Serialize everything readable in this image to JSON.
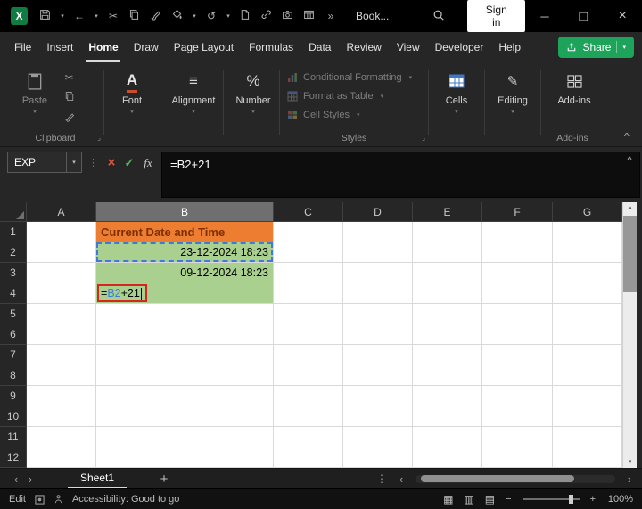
{
  "colors": {
    "excel_green": "#107C41",
    "share_green": "#1EA35B",
    "cell_orange": "#ED7D31",
    "cell_green": "#A9D08E",
    "reference_blue": "#3b7ddd",
    "annotation_red": "#D9261C"
  },
  "glyphs": {
    "dropdown": "▾",
    "undo": "←",
    "redo": "↺",
    "cut": "✂",
    "overflow": "»",
    "dots": "⋮",
    "collapse": "^",
    "nav_left": "‹",
    "nav_right": "›",
    "add": "+",
    "minus": "−",
    "plus": "+",
    "close": "×",
    "minimize": "─",
    "up_arrow": "▴",
    "down_arrow": "▾",
    "font_icon": "A",
    "align_icon": "≡",
    "number_icon": "%",
    "pencil": "✎",
    "view_normal": "▦",
    "view_layout": "▥",
    "view_break": "▤",
    "corner_launcher": "⌟",
    "check": "✓",
    "cancel": "×"
  },
  "title_bar": {
    "doc_title": "Book...",
    "sign_in_label": "Sign in"
  },
  "menu": {
    "items": [
      "File",
      "Insert",
      "Home",
      "Draw",
      "Page Layout",
      "Formulas",
      "Data",
      "Review",
      "View",
      "Developer",
      "Help"
    ],
    "active": "Home",
    "share_label": "Share"
  },
  "ribbon": {
    "paste_label": "Paste",
    "font_label": "Font",
    "alignment_label": "Alignment",
    "number_label": "Number",
    "styles_items": [
      "Conditional Formatting",
      "Format as Table",
      "Cell Styles"
    ],
    "cells_label": "Cells",
    "editing_label": "Editing",
    "addins_button_label": "Add-ins",
    "clipboard_group_label": "Clipboard",
    "styles_group_label": "Styles",
    "addins_group_label": "Add-ins"
  },
  "formula_bar": {
    "name_box_value": "EXP",
    "fx_label": "fx",
    "formula": "=B2+21"
  },
  "grid": {
    "columns": [
      "A",
      "B",
      "C",
      "D",
      "E",
      "F",
      "G"
    ],
    "rows": [
      1,
      2,
      3,
      4,
      5,
      6,
      7,
      8,
      9,
      10,
      11,
      12
    ],
    "selected_column": "B",
    "cells": [
      {
        "ref": "B1",
        "text": "Current Date and Time",
        "fill": "orange"
      },
      {
        "ref": "B2",
        "text": "23-12-2024 18:23",
        "fill": "green",
        "align": "right",
        "reference_highlight": true
      },
      {
        "ref": "B3",
        "text": "09-12-2024 18:23",
        "fill": "green",
        "align": "right"
      },
      {
        "ref": "B4",
        "fill": "green",
        "editing": true,
        "formula_parts": {
          "eq": "=",
          "ref": "B2",
          "rest": "+21"
        }
      }
    ]
  },
  "sheet_bar": {
    "active_tab": "Sheet1"
  },
  "status_bar": {
    "mode": "Edit",
    "accessibility_text": "Accessibility: Good to go",
    "zoom_level": "100%"
  }
}
